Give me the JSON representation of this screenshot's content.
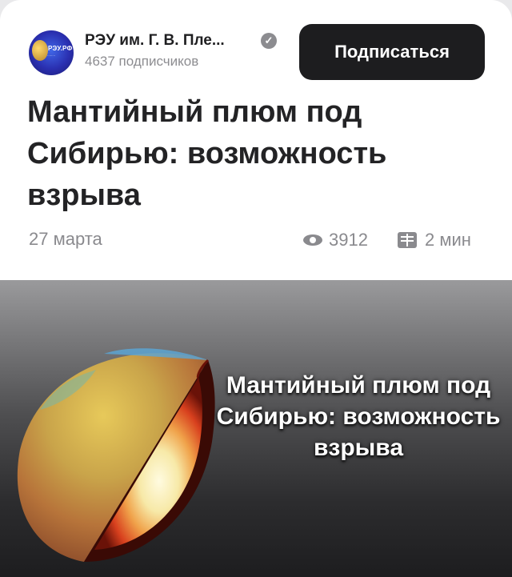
{
  "channel": {
    "name": "РЭУ им. Г. В. Пле...",
    "subscribers": "4637 подписчиков",
    "avatar_text": "РЭУ.РФ",
    "verified_icon": "check-badge-icon"
  },
  "actions": {
    "subscribe_label": "Подписаться"
  },
  "article": {
    "title": "Мантийный плюм под Сибирью: возможность взрыва",
    "date": "27 марта",
    "views": "3912",
    "read_time": "2 мин"
  },
  "image": {
    "headline": "Мантийный плюм под Сибирью: возможность взрыва"
  },
  "colors": {
    "button_bg": "#1d1d1f",
    "meta_text": "#8a8a8e",
    "title_text": "#232325"
  }
}
